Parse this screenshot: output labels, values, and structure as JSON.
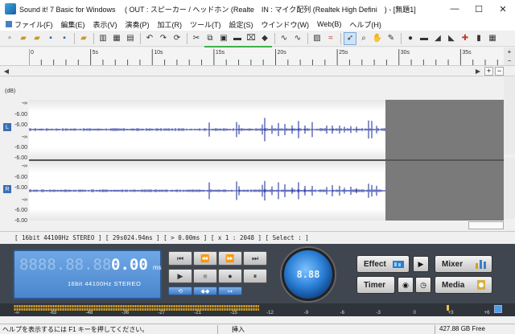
{
  "window": {
    "title": "Sound it! 7 Basic for Windows 　( OUT : スピーカー / ヘッドホン (Realte　IN : マイク配列 (Realtek High Defini　) - [無題1]",
    "minimize_glyph": "—",
    "maximize_glyph": "☐",
    "close_glyph": "✕"
  },
  "menu": [
    {
      "label": "ファイル(F)"
    },
    {
      "label": "編集(E)"
    },
    {
      "label": "表示(V)"
    },
    {
      "label": "演奏(P)"
    },
    {
      "label": "加工(R)"
    },
    {
      "label": "ツール(T)"
    },
    {
      "label": "設定(S)"
    },
    {
      "label": "ウインドウ(W)"
    },
    {
      "label": "Web(B)"
    },
    {
      "label": "ヘルプ(H)"
    }
  ],
  "toolbar_icons": [
    "new-file-icon",
    "open-folder-icon",
    "open-icon",
    "save-icon",
    "save-as-icon",
    "folder-icon",
    "album-icon",
    "cd-icon",
    "export-icon",
    "undo-icon",
    "redo-icon",
    "repeat-icon",
    "cut-icon",
    "copy-icon",
    "paste-icon",
    "delete-icon",
    "trim-icon",
    "mix-icon",
    "zoom-in-wave-icon",
    "zoom-out-wave-icon",
    "spectrum-icon",
    "wave-icon",
    "pointer-icon",
    "zoom-icon",
    "hand-icon",
    "pencil-icon",
    "record-dot-icon",
    "minus-icon",
    "fade-in-icon",
    "fade-out-icon",
    "marker-icon",
    "level-icon",
    "grid-icon"
  ],
  "ruler": {
    "ticks": [
      {
        "t": 0,
        "label": "0"
      },
      {
        "t": 5,
        "label": "5s"
      },
      {
        "t": 10,
        "label": "10s"
      },
      {
        "t": 15,
        "label": "15s"
      },
      {
        "t": 20,
        "label": "20s"
      },
      {
        "t": 25,
        "label": "25s"
      },
      {
        "t": 30,
        "label": "30s"
      },
      {
        "t": 35,
        "label": "35s"
      }
    ],
    "max_t": 38.5,
    "zoom_plus": "+",
    "zoom_minus": "−"
  },
  "overview": {
    "left": "◀",
    "right": "▶",
    "plus": "+",
    "minus": "−"
  },
  "waveform": {
    "db_unit": "(dB)",
    "channels": [
      {
        "badge": "L",
        "labels": [
          "-∞",
          "-6.00",
          "-6.00",
          "-∞",
          "-6.00",
          "-6.00"
        ]
      },
      {
        "badge": "R",
        "labels": [
          "-∞",
          "-6.00",
          "-6.00",
          "-∞",
          "-6.00",
          "-6.00"
        ]
      }
    ],
    "duration_s": 29.02494,
    "visible_s": 38.5
  },
  "statusline": "[ 16bit  44100Hz  STEREO ] [ 29s024.94ms ] [ > 0.00ms ] [ x 1 : 2048 ] [ Select : ]",
  "transport": {
    "lcd_ghost": "8888.88.88",
    "time": "0.00",
    "time_unit": "ms",
    "info": "16bit  44100Hz STEREO",
    "buttons": {
      "to_start": "⏮",
      "rewind": "⏪",
      "fast_forward": "⏩",
      "to_end": "⏭",
      "play": "▶",
      "stop": "■",
      "record": "●",
      "pause": "⏸",
      "loop": "⟲",
      "marker": "◆◆",
      "jump": "↦"
    },
    "knob": "8.88",
    "effect_label": "Effect",
    "effect_play": "▶",
    "mixer_label": "Mixer",
    "timer_label": "Timer",
    "timer_rec": "◉",
    "timer_clock": "◷",
    "media_label": "Media"
  },
  "meter": {
    "scale": [
      "-∞",
      "-63",
      "-48",
      "-36",
      "-27",
      "-21",
      "-15",
      "-12",
      "-9",
      "-6",
      "-3",
      "0",
      "+3",
      "+6"
    ]
  },
  "statusbar": {
    "help": "ヘルプを表示するには F1 キーを押してください。",
    "mode": "挿入",
    "disk": "427.88 GB Free"
  },
  "colors": {
    "wave": "#3a4aa8",
    "lcd": "#4a86cc",
    "panel": "#40464f",
    "meter_fill": "#e0a820"
  }
}
